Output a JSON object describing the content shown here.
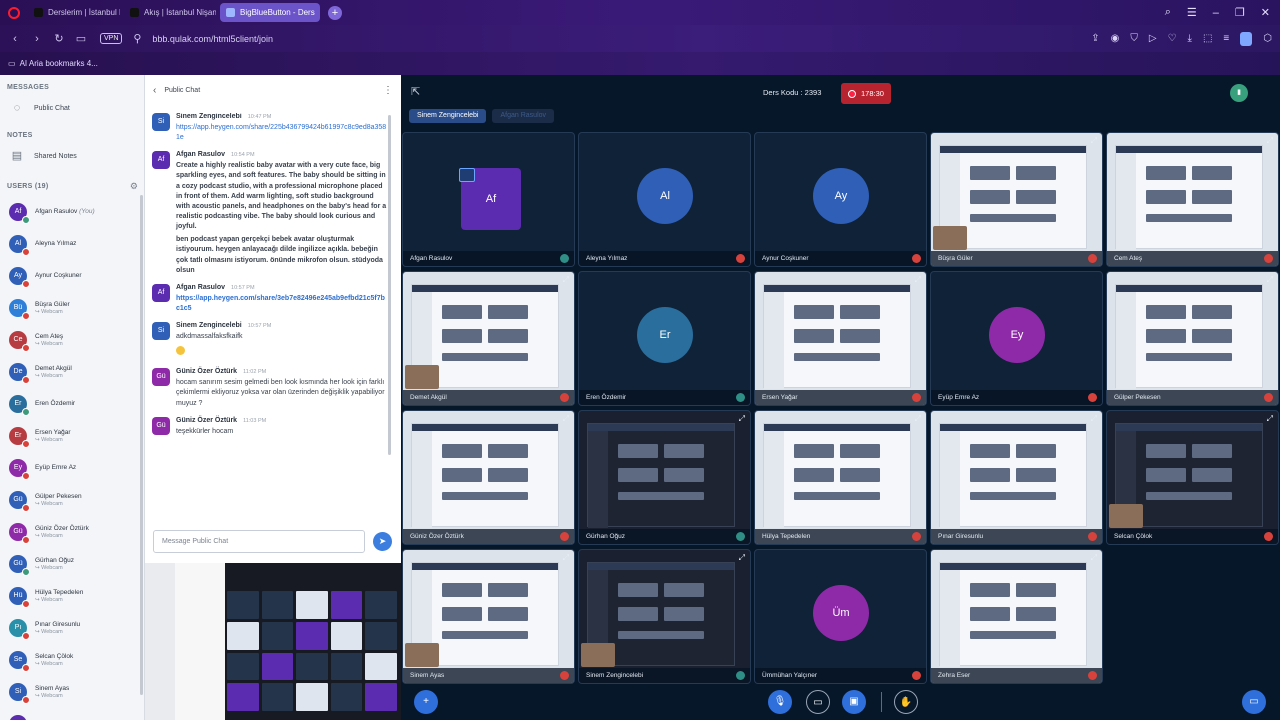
{
  "browser": {
    "tabs": [
      {
        "label": "Derslerim | İstanbul Nişan…",
        "active": false
      },
      {
        "label": "Akış | İstanbul Nişantaşı Ü…",
        "active": false
      },
      {
        "label": "BigBlueButton - Ders",
        "active": true
      }
    ],
    "vpn_label": "VPN",
    "url": "bbb.qulak.com/html5client/join",
    "bookmark": "AI Aria bookmarks 4..."
  },
  "sidebar": {
    "messages_title": "MESSAGES",
    "public_chat": "Public Chat",
    "notes_title": "NOTES",
    "shared_notes": "Shared Notes",
    "users_title": "USERS (19)",
    "users": [
      {
        "initials": "Af",
        "name": "Afgan Rasulov",
        "sub": "",
        "you": "(You)",
        "color": "#5b2bb0",
        "mic": "on"
      },
      {
        "initials": "Al",
        "name": "Aleyna Yılmaz",
        "sub": "",
        "color": "#2f5fb7",
        "mic": "off"
      },
      {
        "initials": "Ay",
        "name": "Aynur Coşkuner",
        "sub": "",
        "color": "#2f5fb7",
        "mic": "off"
      },
      {
        "initials": "Bü",
        "name": "Büşra Güler",
        "sub": "↪ Webcam",
        "color": "#2f7fd9",
        "mic": "off"
      },
      {
        "initials": "Ce",
        "name": "Cem Ateş",
        "sub": "↪ Webcam",
        "color": "#b63c41",
        "mic": "off"
      },
      {
        "initials": "De",
        "name": "Demet Akgül",
        "sub": "↪ Webcam",
        "color": "#2f5fb7",
        "mic": "off"
      },
      {
        "initials": "Er",
        "name": "Eren Özdemir",
        "sub": "",
        "color": "#2a6e9d",
        "mic": "on"
      },
      {
        "initials": "Er",
        "name": "Ersen Yağar",
        "sub": "↪ Webcam",
        "color": "#b63c41",
        "mic": "off"
      },
      {
        "initials": "Ey",
        "name": "Eyüp Emre Az",
        "sub": "",
        "color": "#8e2aa8",
        "mic": "off"
      },
      {
        "initials": "Gü",
        "name": "Gülper Pekesen",
        "sub": "↪ Webcam",
        "color": "#2f5fb7",
        "mic": "off"
      },
      {
        "initials": "Gü",
        "name": "Güniz Özer Öztürk",
        "sub": "↪ Webcam",
        "color": "#8e2aa8",
        "mic": "off"
      },
      {
        "initials": "Gü",
        "name": "Gürhan Oğuz",
        "sub": "↪ Webcam",
        "color": "#2f5fb7",
        "mic": "on"
      },
      {
        "initials": "Hü",
        "name": "Hülya Tepedelen",
        "sub": "↪ Webcam",
        "color": "#2f5fb7",
        "mic": "off"
      },
      {
        "initials": "Pı",
        "name": "Pınar Giresunlu",
        "sub": "↪ Webcam",
        "color": "#2a8fa8",
        "mic": "off"
      },
      {
        "initials": "Se",
        "name": "Selcan Çölok",
        "sub": "↪ Webcam",
        "color": "#2f5fb7",
        "mic": "off"
      },
      {
        "initials": "Si",
        "name": "Sinem Ayas",
        "sub": "↪ Webcam",
        "color": "#2f5fb7",
        "mic": "off"
      },
      {
        "initials": "Si",
        "name": "Sinem Zengincelebi",
        "sub": "",
        "color": "#5b2bb0",
        "mic": "off"
      }
    ]
  },
  "chat": {
    "title": "Public Chat",
    "placeholder": "Message Public Chat",
    "messages": [
      {
        "initials": "Si",
        "color": "#2f5fb7",
        "name": "Sinem Zengincelebi",
        "time": "10:47 PM",
        "parts": [
          {
            "kind": "link",
            "text": "https://app.heygen.com/share/225b436799424b61997c8c9ed8a3581e"
          }
        ]
      },
      {
        "initials": "Af",
        "color": "#5b2bb0",
        "name": "Afgan Rasulov",
        "time": "10:54 PM",
        "parts": [
          {
            "kind": "bold",
            "text": "Create a highly realistic baby avatar with a very cute face, big sparkling eyes, and soft features. The baby should be sitting in a cozy podcast studio, with a professional microphone placed in front of them. Add warm lighting, soft studio background with acoustic panels, and headphones on the baby's head for a realistic podcasting vibe. The baby should look curious and joyful."
          },
          {
            "kind": "bold",
            "text": "ben podcast yapan gerçekçi bebek avatar oluşturmak istiyourum. heygen anlayacağı dilde ingilizce açıkla. bebeğin çok tatlı olmasını istiyorum. önünde mikrofon olsun. stüdyoda olsun"
          }
        ]
      },
      {
        "initials": "Af",
        "color": "#5b2bb0",
        "name": "Afgan Rasulov",
        "time": "10:57 PM",
        "parts": [
          {
            "kind": "linkbold",
            "text": "https://app.heygen.com/share/3eb7e82496e245ab9efbd21c5f7bc1c5"
          }
        ]
      },
      {
        "initials": "Si",
        "color": "#2f5fb7",
        "name": "Sinem Zengincelebi",
        "time": "10:57 PM",
        "parts": [
          {
            "kind": "text",
            "text": "adkdmassalfaksfkaifk"
          }
        ],
        "emoji": true
      },
      {
        "initials": "Gü",
        "color": "#8e2aa8",
        "name": "Güniz Özer Öztürk",
        "time": "11:02 PM",
        "parts": [
          {
            "kind": "text",
            "text": "hocam sanırım sesim gelmedi ben look kısmında her look için farklı çekimlermi ekliyoruz yoksa var olan üzerinden değişiklik yapabiliyor muyuz ?"
          }
        ]
      },
      {
        "initials": "Gü",
        "color": "#8e2aa8",
        "name": "Güniz Özer Öztürk",
        "time": "11:03 PM",
        "parts": [
          {
            "kind": "text",
            "text": "teşekkürler hocam"
          }
        ]
      }
    ]
  },
  "main": {
    "room_title": "Ders Kodu : 2393",
    "rec_time": "178:30",
    "talking": [
      "Sinem Zengincelebi",
      "Afgan Rasulov"
    ],
    "tiles": [
      {
        "name": "Afgan Rasulov",
        "type": "avatar-sq",
        "initials": "Af",
        "color": "#5b2bb0",
        "mic": "on",
        "present": true
      },
      {
        "name": "Aleyna Yılmaz",
        "type": "avatar",
        "initials": "Al",
        "color": "#2f5fb7",
        "mic": "off"
      },
      {
        "name": "Aynur Coşkuner",
        "type": "avatar",
        "initials": "Ay",
        "color": "#2f5fb7",
        "mic": "off"
      },
      {
        "name": "Büşra Güler",
        "type": "screen",
        "mic": "off",
        "dark": false,
        "pip": true
      },
      {
        "name": "Cem Ateş",
        "type": "screen",
        "mic": "off",
        "dark": false,
        "pip": false
      },
      {
        "name": "Demet Akgül",
        "type": "screen",
        "mic": "off",
        "dark": false,
        "pip": true
      },
      {
        "name": "Eren Özdemir",
        "type": "avatar",
        "initials": "Er",
        "color": "#2a6e9d",
        "mic": "on"
      },
      {
        "name": "Ersen Yağar",
        "type": "screen",
        "mic": "off",
        "dark": false,
        "pip": false
      },
      {
        "name": "Eyüp Emre Az",
        "type": "avatar",
        "initials": "Ey",
        "color": "#8e2aa8",
        "mic": "off"
      },
      {
        "name": "Gülper Pekesen",
        "type": "screen",
        "mic": "off",
        "dark": false,
        "pip": false
      },
      {
        "name": "Güniz Özer Öztürk",
        "type": "screen",
        "mic": "off",
        "dark": false,
        "pip": false
      },
      {
        "name": "Gürhan Oğuz",
        "type": "screen",
        "mic": "on",
        "dark": true,
        "pip": false
      },
      {
        "name": "Hülya Tepedelen",
        "type": "screen",
        "mic": "off",
        "dark": false,
        "pip": false
      },
      {
        "name": "Pınar Giresunlu",
        "type": "screen",
        "mic": "off",
        "dark": false,
        "pip": false
      },
      {
        "name": "Selcan Çölok",
        "type": "screen",
        "mic": "off",
        "dark": true,
        "pip": true
      },
      {
        "name": "Sinem Ayas",
        "type": "screen",
        "mic": "off",
        "dark": false,
        "pip": true
      },
      {
        "name": "Sinem Zengincelebi",
        "type": "screen",
        "mic": "on",
        "dark": true,
        "pip": true
      },
      {
        "name": "Ümmühan Yalçıner",
        "type": "avatar",
        "initials": "Üm",
        "color": "#8e2aa8",
        "mic": "off"
      },
      {
        "name": "Zehra Eser",
        "type": "screen",
        "mic": "off",
        "dark": false,
        "pip": false
      }
    ]
  }
}
